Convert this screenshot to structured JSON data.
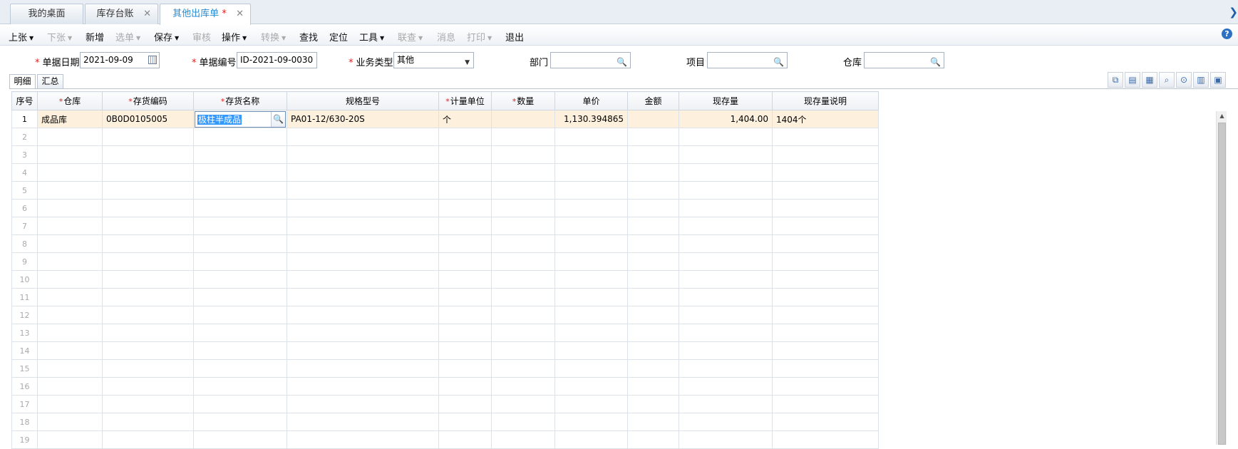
{
  "tabs": [
    {
      "label": "我的桌面",
      "closable": false
    },
    {
      "label": "库存台账",
      "closable": true
    },
    {
      "label": "其他出库单",
      "closable": true,
      "modified_mark": "*",
      "active": true
    }
  ],
  "toolbar": {
    "items": [
      {
        "label": "上张",
        "dropdown": true,
        "enabled": true
      },
      {
        "label": "下张",
        "dropdown": true,
        "enabled": false
      },
      {
        "label": "新增",
        "dropdown": false,
        "enabled": true
      },
      {
        "label": "选单",
        "dropdown": true,
        "enabled": false
      },
      {
        "label": "保存",
        "dropdown": true,
        "enabled": true
      },
      {
        "label": "审核",
        "dropdown": false,
        "enabled": false
      },
      {
        "label": "操作",
        "dropdown": true,
        "enabled": true
      },
      {
        "label": "转换",
        "dropdown": true,
        "enabled": false
      },
      {
        "label": "查找",
        "dropdown": false,
        "enabled": true
      },
      {
        "label": "定位",
        "dropdown": false,
        "enabled": true
      },
      {
        "label": "工具",
        "dropdown": true,
        "enabled": true
      },
      {
        "label": "联查",
        "dropdown": true,
        "enabled": false
      },
      {
        "label": "消息",
        "dropdown": false,
        "enabled": false
      },
      {
        "label": "打印",
        "dropdown": true,
        "enabled": false
      },
      {
        "label": "退出",
        "dropdown": false,
        "enabled": true
      }
    ],
    "help_icon": "?"
  },
  "form": {
    "date_label": "单据日期",
    "date_value": "2021-09-09",
    "code_label": "单据编号",
    "code_value": "ID-2021-09-0030",
    "type_label": "业务类型",
    "type_value": "其他",
    "dept_label": "部门",
    "dept_value": "",
    "project_label": "项目",
    "project_value": "",
    "warehouse_label": "仓库",
    "warehouse_value": "",
    "required_mark": "*"
  },
  "subtabs": [
    "明细",
    "汇总"
  ],
  "grid": {
    "columns": [
      {
        "label": "序号",
        "required": false
      },
      {
        "label": "仓库",
        "required": true
      },
      {
        "label": "存货编码",
        "required": true
      },
      {
        "label": "存货名称",
        "required": true
      },
      {
        "label": "规格型号",
        "required": false
      },
      {
        "label": "计量单位",
        "required": true
      },
      {
        "label": "数量",
        "required": true
      },
      {
        "label": "单价",
        "required": false
      },
      {
        "label": "金额",
        "required": false
      },
      {
        "label": "现存量",
        "required": false
      },
      {
        "label": "现存量说明",
        "required": false
      }
    ],
    "rows": [
      {
        "no": "1",
        "warehouse": "成品库",
        "code": "0B0D0105005",
        "name": "极柱半成品",
        "spec": "PA01-12/630-20S",
        "unit": "个",
        "qty": "",
        "price": "1,130.394865",
        "amount": "",
        "stock": "1,404.00",
        "stock_note": "1404个"
      }
    ],
    "empty_row_numbers": [
      "2",
      "3",
      "4",
      "5",
      "6",
      "7",
      "8",
      "9",
      "10",
      "11",
      "12",
      "13",
      "14",
      "15",
      "16",
      "17",
      "18",
      "19"
    ]
  },
  "colors": {
    "accent": "#2a8bd0",
    "required": "#e02020",
    "selected_row": "#fdf0dc",
    "selection": "#3399ff"
  }
}
